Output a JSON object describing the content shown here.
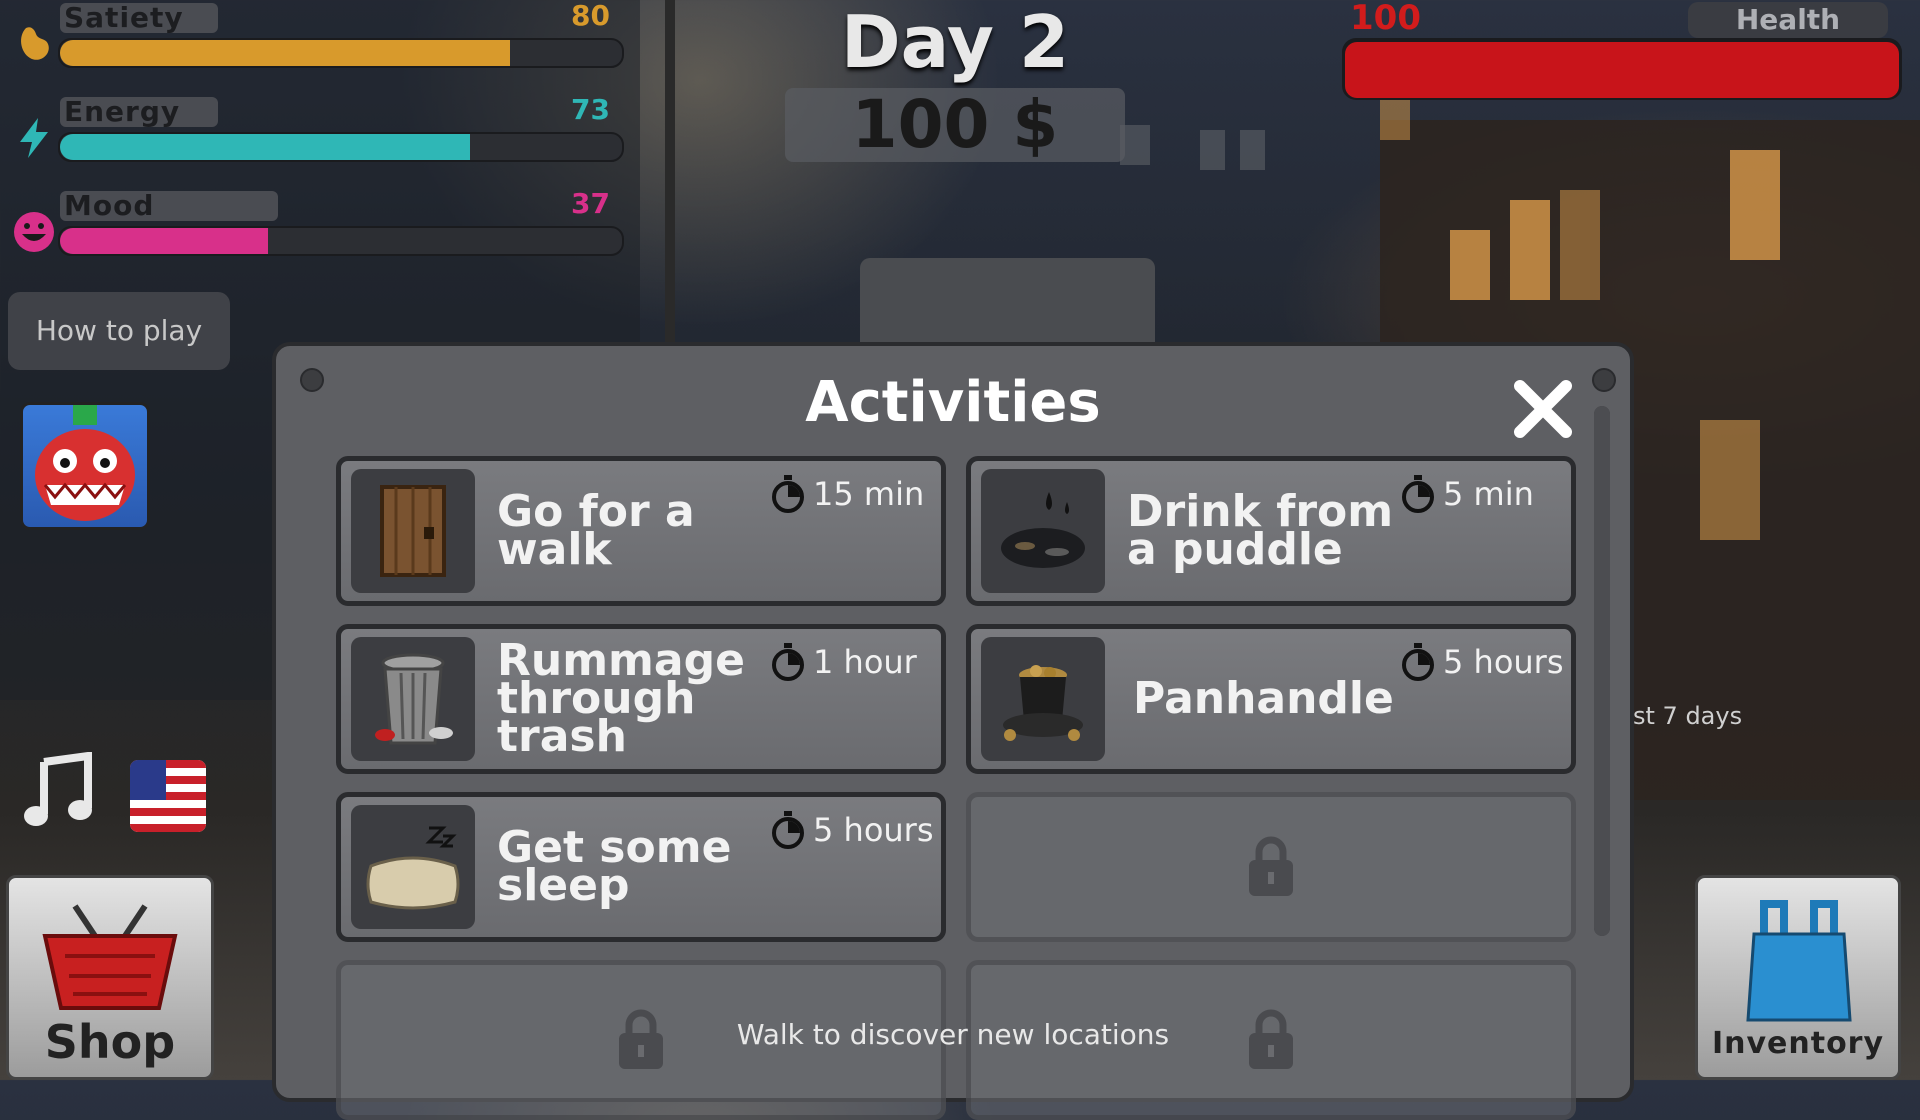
{
  "stats": [
    {
      "label": "Satiety",
      "value": "80",
      "fill": 0.8,
      "color": "#d89a2c"
    },
    {
      "label": "Energy",
      "value": "73",
      "fill": 0.73,
      "color": "#2fb7b6"
    },
    {
      "label": "Mood",
      "value": "37",
      "fill": 0.37,
      "color": "#d8308a"
    }
  ],
  "header": {
    "day": "Day 2",
    "money": "100 $"
  },
  "health": {
    "label": "Health",
    "value": "100",
    "fill": 1.0
  },
  "left_panel": {
    "how_to_play": "How to play",
    "shop": "Shop"
  },
  "right_panel": {
    "inventory": "Inventory",
    "side_note": "st 7 days"
  },
  "modal": {
    "title": "Activities",
    "activities": [
      {
        "label": "Go for a walk",
        "time": "15 min",
        "icon": "door-icon"
      },
      {
        "label": "Drink from a puddle",
        "time": "5 min",
        "icon": "puddle-icon"
      },
      {
        "label": "Rummage through trash",
        "time": "1 hour",
        "icon": "trash-can-icon"
      },
      {
        "label": "Panhandle",
        "time": "5 hours",
        "icon": "hat-with-coins-icon"
      },
      {
        "label": "Get some sleep",
        "time": "5 hours",
        "icon": "pillow-icon"
      }
    ],
    "hint": "Walk to discover new locations"
  }
}
